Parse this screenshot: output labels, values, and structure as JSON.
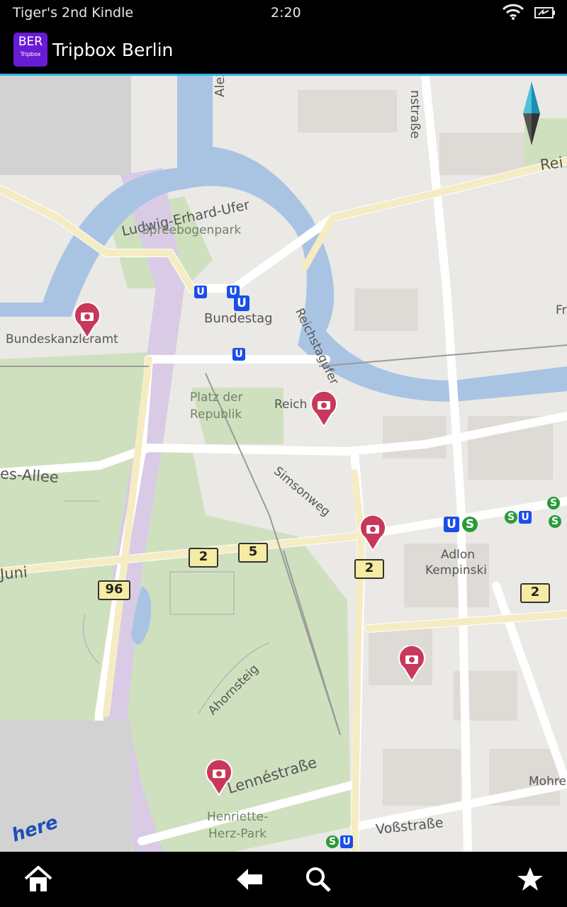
{
  "status_bar": {
    "device_name": "Tiger's 2nd Kindle",
    "time": "2:20",
    "icons": [
      "wifi-icon",
      "battery-icon"
    ]
  },
  "app_bar": {
    "icon_code": "BER",
    "icon_sub": "Tripbox",
    "title": "Tripbox Berlin"
  },
  "map": {
    "labels": {
      "alexanderufer": "Alexanderufer",
      "ludwig": "Ludwig-Erhard-Ufer",
      "spreebogenpark": "Spreebogenpark",
      "bundestag": "Bundestag",
      "bundeskanzleramt": "Bundeskanzleramt",
      "reichstagufer": "Reichstagufer",
      "platz_der_republik_1": "Platz der",
      "platz_der_republik_2": "Republik",
      "reich": "Reich",
      "allee": "es-Allee",
      "simsonweg": "Simsonweg",
      "juni": "Juni",
      "adlon_1": "Adlon",
      "adlon_2": "Kempinski",
      "ahornsteig": "Ahornsteig",
      "lennestrasse": "Lennéstraße",
      "vossstrasse": "Voßstraße",
      "henriette_1": "Henriette-",
      "henriette_2": "Herz-Park",
      "mohre": "Mohre",
      "nstrasse": "nstraße",
      "reic": "Rei",
      "fr": "Fr"
    },
    "route_shields": [
      "2",
      "5",
      "96",
      "2",
      "2"
    ],
    "transit": {
      "u": "U",
      "s": "S"
    },
    "logo": "here"
  },
  "nav_bar": {
    "items": [
      "home-icon",
      "back-icon",
      "search-icon",
      "favorites-icon"
    ]
  }
}
